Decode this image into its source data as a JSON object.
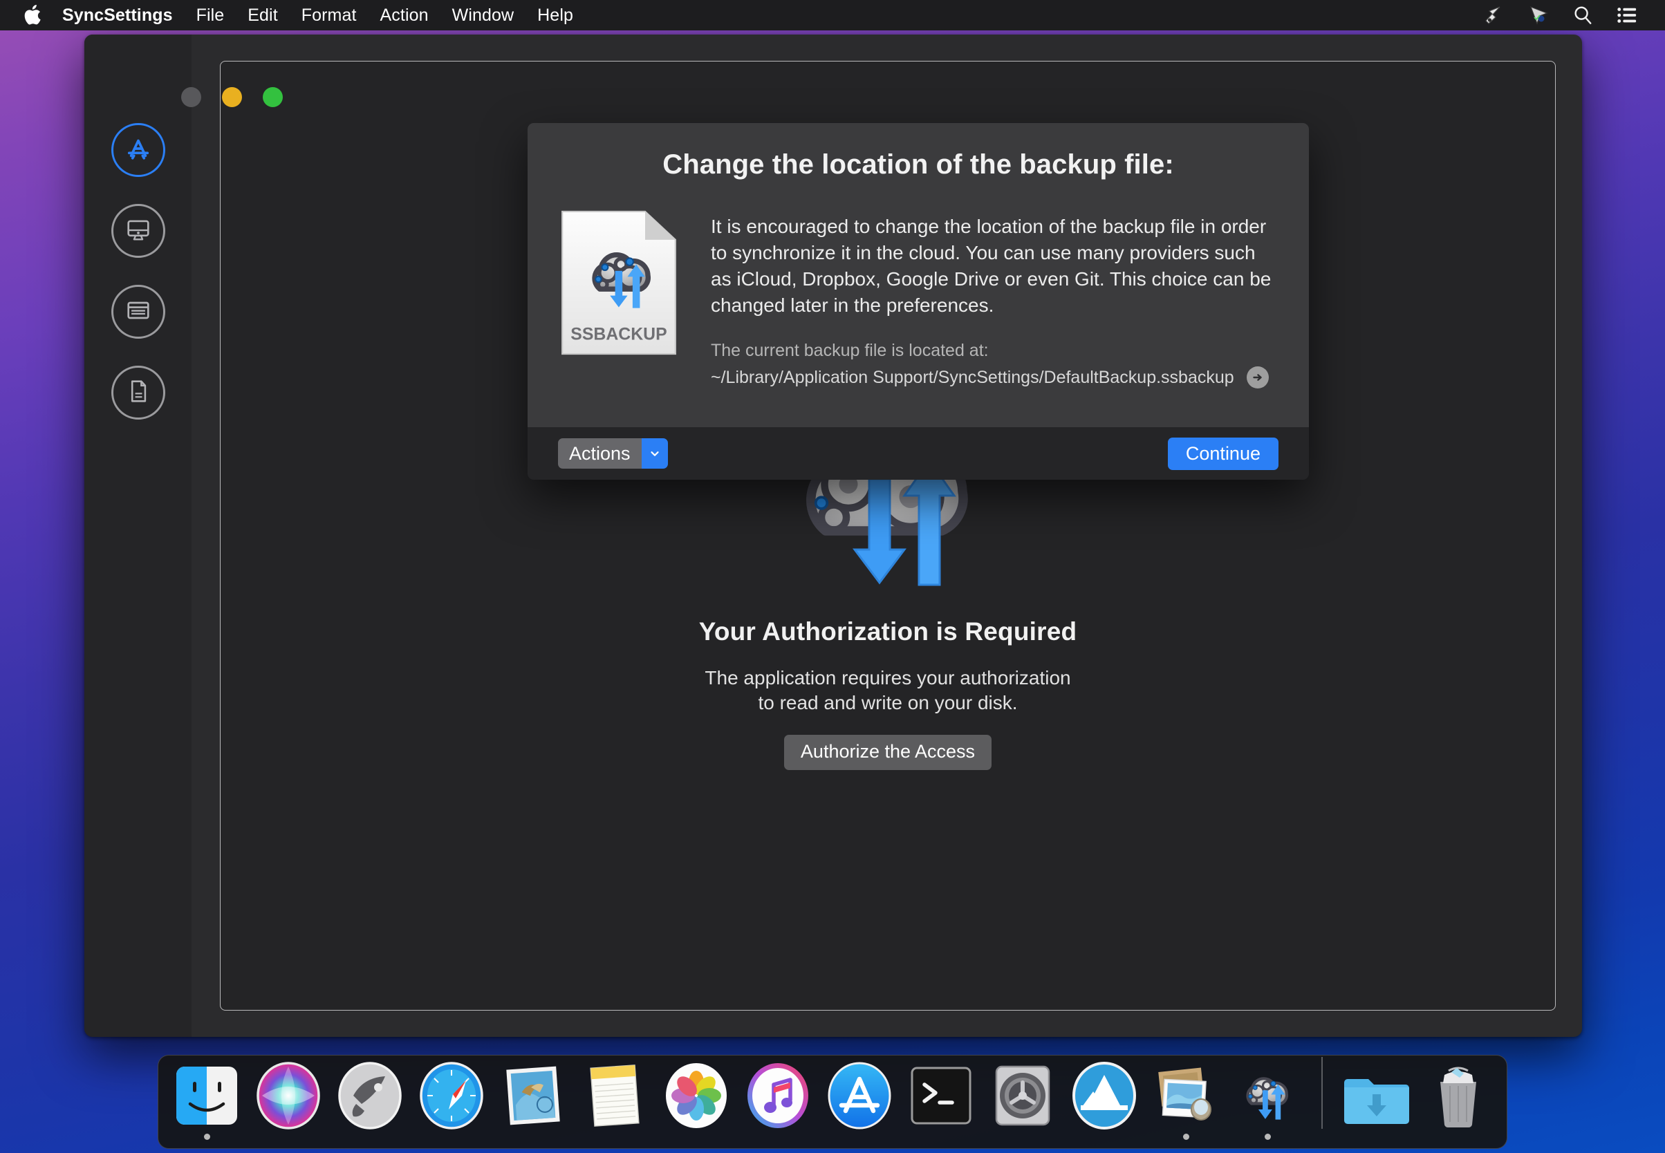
{
  "menubar": {
    "apple_icon": "apple-logo",
    "items": [
      {
        "label": "SyncSettings",
        "bold": true
      },
      {
        "label": "File"
      },
      {
        "label": "Edit"
      },
      {
        "label": "Format"
      },
      {
        "label": "Action"
      },
      {
        "label": "Window"
      },
      {
        "label": "Help"
      }
    ],
    "status_icons": [
      "cursor-arrow-icon",
      "cursor-arrow-badge-icon",
      "search-icon",
      "control-center-list-icon"
    ]
  },
  "window": {
    "traffic_lights": {
      "close": "close-disabled",
      "minimize": "minimize",
      "zoom": "zoom"
    },
    "sidebar": {
      "items": [
        {
          "name": "apps",
          "icon": "app-store-icon",
          "active": true
        },
        {
          "name": "display",
          "icon": "monitor-icon",
          "active": false
        },
        {
          "name": "windows",
          "icon": "window-panel-icon",
          "active": false
        },
        {
          "name": "documents",
          "icon": "document-icon",
          "active": false
        }
      ]
    },
    "authorization": {
      "graphic": "sync-cloud-gears-icon",
      "title": "Your Authorization is Required",
      "description_line1": "The application requires your authorization",
      "description_line2": "to read and write on your disk.",
      "button_label": "Authorize the Access"
    }
  },
  "sheet": {
    "title": "Change the location of the backup file:",
    "file_icon_label": "SSBACKUP",
    "paragraph": "It is encouraged to change the location of the backup file in order to synchronize it in the cloud. You can use many providers such as iCloud, Dropbox, Google Drive or even Git. This choice can be changed later in the preferences.",
    "located_label": "The current backup file is located at:",
    "path": "~/Library/Application Support/SyncSettings/DefaultBackup.ssbackup",
    "reveal_icon": "arrow-right-circle-icon",
    "actions_label": "Actions",
    "actions_caret_icon": "chevron-down-icon",
    "continue_label": "Continue"
  },
  "dock": {
    "items": [
      {
        "name": "finder",
        "icon": "finder-icon",
        "running": true
      },
      {
        "name": "siri",
        "icon": "siri-icon",
        "running": false
      },
      {
        "name": "launchpad",
        "icon": "launchpad-rocket-icon",
        "running": false
      },
      {
        "name": "safari",
        "icon": "safari-compass-icon",
        "running": false
      },
      {
        "name": "mail",
        "icon": "mail-stamp-icon",
        "running": false
      },
      {
        "name": "notes",
        "icon": "notes-pad-icon",
        "running": false
      },
      {
        "name": "photos",
        "icon": "photos-pinwheel-icon",
        "running": false
      },
      {
        "name": "itunes",
        "icon": "itunes-note-icon",
        "running": false
      },
      {
        "name": "app-store",
        "icon": "app-store-icon",
        "running": false
      },
      {
        "name": "terminal",
        "icon": "terminal-prompt-icon",
        "running": false
      },
      {
        "name": "system-preferences",
        "icon": "system-preferences-gear-icon",
        "running": false
      },
      {
        "name": "xcode-mountain",
        "icon": "blue-mountain-icon",
        "running": false
      },
      {
        "name": "preview",
        "icon": "preview-photos-icon",
        "running": true
      },
      {
        "name": "syncsettings",
        "icon": "sync-cloud-gears-icon",
        "running": true
      }
    ],
    "trailing": [
      {
        "name": "downloads",
        "icon": "downloads-folder-icon"
      },
      {
        "name": "trash",
        "icon": "trash-icon"
      }
    ]
  },
  "colors": {
    "accent_blue": "#2b7ff5",
    "window_bg": "#2b2b2d",
    "sheet_bg": "#3b3b3d",
    "sheet_footer_bg": "#252527",
    "content_bg": "#242426",
    "menubar_bg": "#1d1d1f",
    "traffic_yellow": "#e9b020",
    "traffic_green": "#33c13f"
  }
}
